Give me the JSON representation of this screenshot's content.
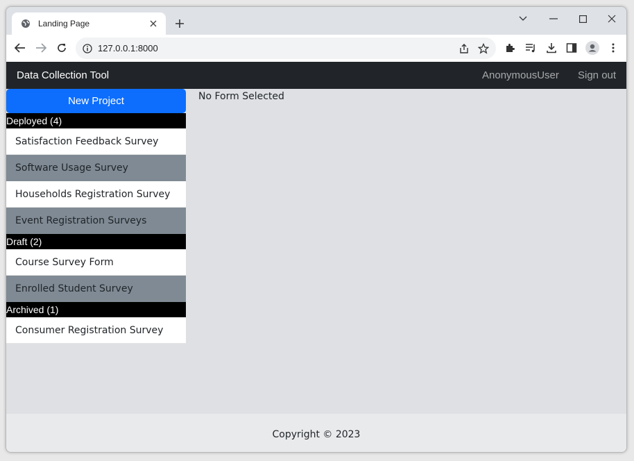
{
  "browser": {
    "tab_title": "Landing Page",
    "url": "127.0.0.1:8000"
  },
  "navbar": {
    "brand": "Data Collection Tool",
    "user": "AnonymousUser",
    "signout": "Sign out"
  },
  "sidebar": {
    "new_project": "New Project",
    "groups": [
      {
        "header": "Deployed (4)",
        "items": [
          "Satisfaction Feedback Survey",
          "Software Usage Survey",
          "Households Registration Survey",
          "Event Registration Surveys"
        ]
      },
      {
        "header": "Draft (2)",
        "items": [
          "Course Survey Form",
          "Enrolled Student Survey"
        ]
      },
      {
        "header": "Archived (1)",
        "items": [
          "Consumer Registration Survey"
        ]
      }
    ]
  },
  "main": {
    "message": "No Form Selected"
  },
  "footer": {
    "copyright": "Copyright © 2023"
  },
  "colors": {
    "primary": "#0d6efd",
    "navbar": "#212529",
    "item_gray": "#7f8a94"
  }
}
